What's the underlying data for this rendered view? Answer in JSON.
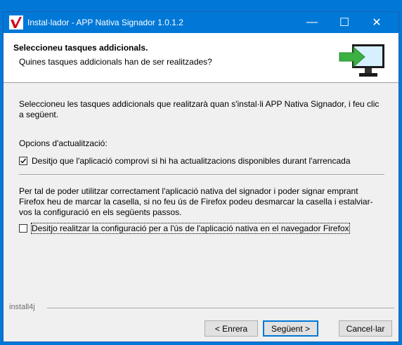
{
  "window": {
    "title": "Instal·lador - APP Nativa Signador 1.0.1.2",
    "minimize_label": "—",
    "maximize_label": "☐",
    "close_label": "✕"
  },
  "header": {
    "title": "Seleccioneu tasques addicionals.",
    "subtitle": "Quines tasques addicionals han de ser realitzades?"
  },
  "content": {
    "intro": "Seleccioneu les tasques addicionals que realitzarà quan s'instal·li APP Nativa Signador, i feu clic a següent.",
    "options_label": "Opcions d'actualització:",
    "check_updates": {
      "label": "Desitjo que l'aplicació comprovi si hi ha actualitzacions disponibles durant l'arrencada",
      "checked": true
    },
    "firefox_note": "Per tal de poder utilitzar correctament l'aplicació nativa del signador i poder signar emprant Firefox heu de marcar la casella, si no feu ús de Firefox podeu desmarcar la casella i estalviar-vos la configuració en els següents passos.",
    "firefox_config": {
      "label": "Desitjo realitzar la configuració per a l'ús de l'aplicació nativa en el navegador Firefox",
      "checked": false
    }
  },
  "footer": {
    "brand": "install4j",
    "back_label": "< Enrera",
    "next_label": "Següent >",
    "cancel_label": "Cancel·lar"
  },
  "colors": {
    "titlebar": "#0078d7",
    "arrow": "#3cb043",
    "screen": "#d6f0ff"
  }
}
